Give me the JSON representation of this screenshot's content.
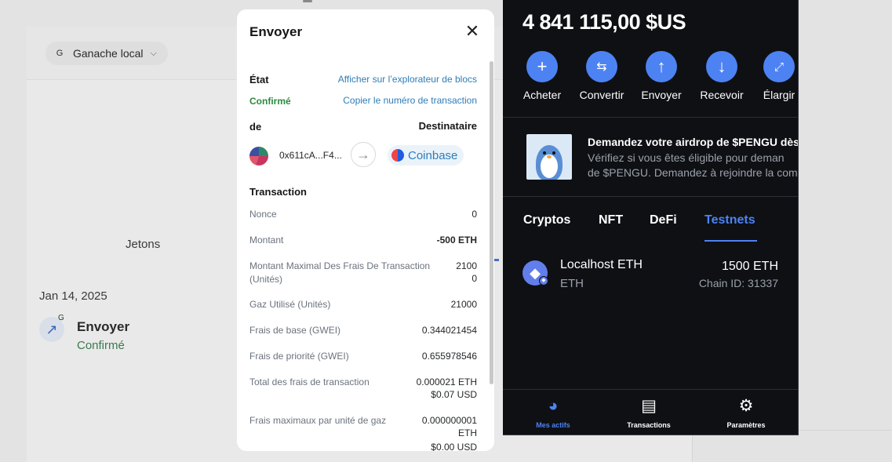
{
  "background": {
    "network_badge": "G",
    "network_name": "Ganache local",
    "tokens_tab": "Jetons",
    "date": "Jan 14, 2025",
    "tx_badge": "G",
    "tx_title": "Envoyer",
    "tx_status": "Confirmé"
  },
  "modal": {
    "title": "Envoyer",
    "state_label": "État",
    "explorer_link": "Afficher sur l’explorateur de blocs",
    "state_value": "Confirmé",
    "copy_link": "Copier le numéro de transaction",
    "from_label": "de",
    "to_label": "Destinataire",
    "from_address": "0x611cA...F4...",
    "to_name": "Coinbase",
    "transaction_heading": "Transaction",
    "rows": [
      {
        "label": "Nonce",
        "value": "0"
      },
      {
        "label": "Montant",
        "value": "-500 ETH"
      },
      {
        "label": "Montant Maximal Des Frais De Transaction (Unités)",
        "value": "2100 0"
      },
      {
        "label": "Gaz Utilisé (Unités)",
        "value": "21000"
      },
      {
        "label": "Frais de base (GWEI)",
        "value": "0.344021454"
      },
      {
        "label": "Frais de priorité (GWEI)",
        "value": "0.655978546"
      },
      {
        "label": "Total des frais de transaction",
        "value": "0.000021 ETH",
        "value2": "$0.07 USD"
      },
      {
        "label": "Frais maximaux par unité de gaz",
        "value": "0.000000001 ETH",
        "value2": "$0.00 USD"
      }
    ]
  },
  "wallet": {
    "balance": "4 841 115,00 $US",
    "actions": [
      {
        "label": "Acheter",
        "icon": "plus-icon"
      },
      {
        "label": "Convertir",
        "icon": "swap-icon"
      },
      {
        "label": "Envoyer",
        "icon": "arrow-up-icon"
      },
      {
        "label": "Recevoir",
        "icon": "arrow-down-icon"
      },
      {
        "label": "Élargir",
        "icon": "expand-icon"
      }
    ],
    "promo": {
      "title": "Demandez votre airdrop de $PENGU dès",
      "line1": "Vérifiez si vous êtes éligible pour deman",
      "line2": "de $PENGU. Demandez à rejoindre la com"
    },
    "tabs": [
      "Cryptos",
      "NFT",
      "DeFi",
      "Testnets"
    ],
    "active_tab": "Testnets",
    "token": {
      "name": "Localhost ETH",
      "symbol": "ETH",
      "amount": "1500 ETH",
      "chain": "Chain ID: 31337"
    },
    "nav": [
      "Mes actifs",
      "Transactions",
      "Paramètres"
    ],
    "accent_color": "#4d82f3"
  }
}
